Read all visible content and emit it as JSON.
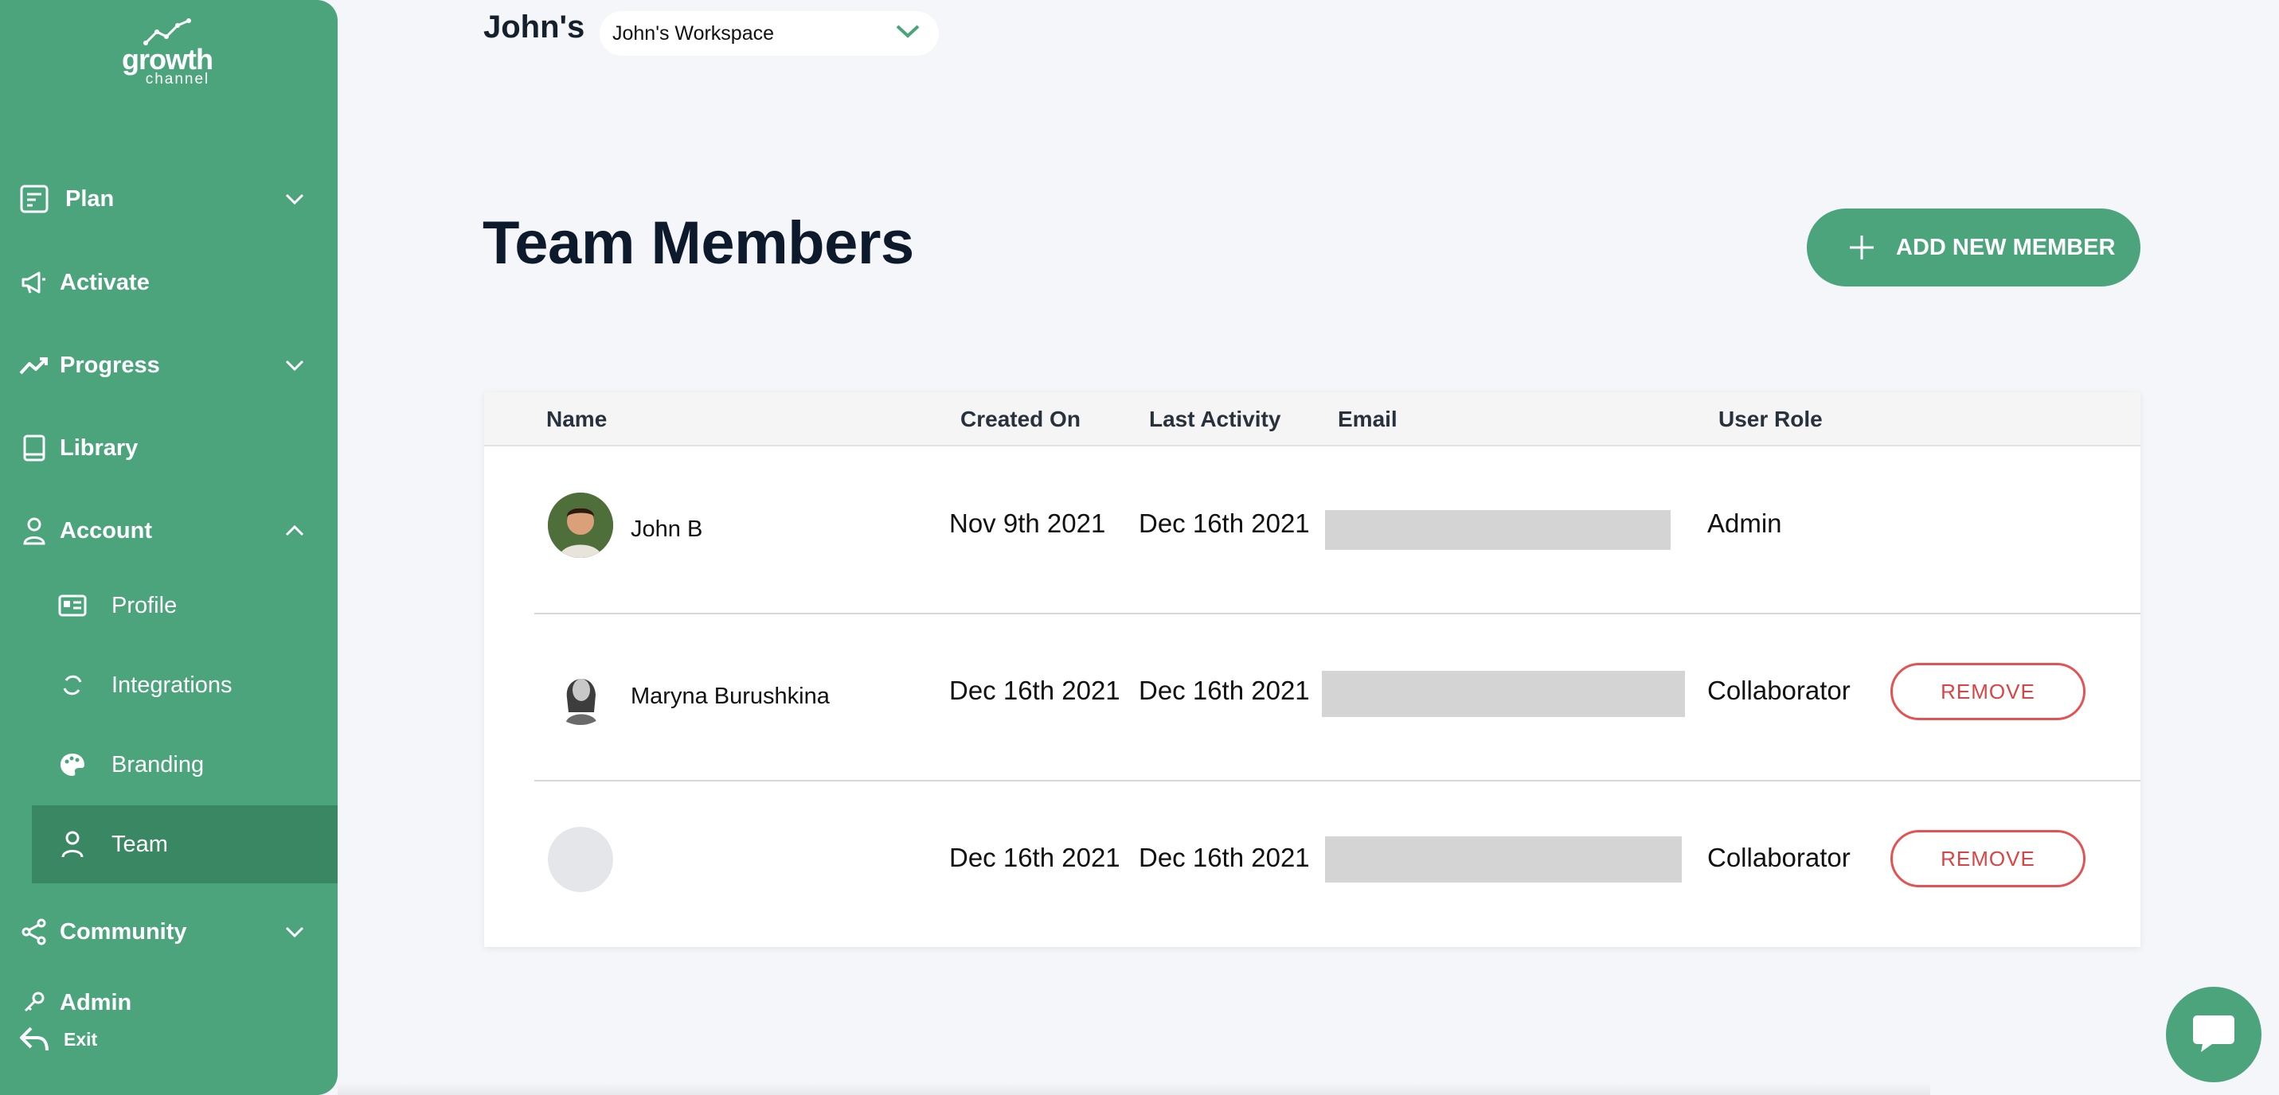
{
  "sidebar": {
    "logo": {
      "line1": "growth",
      "line2": "channel"
    },
    "items": [
      {
        "label": "Plan",
        "icon": "plan-icon",
        "chevron": "down"
      },
      {
        "label": "Activate",
        "icon": "megaphone-icon"
      },
      {
        "label": "Progress",
        "icon": "trend-icon",
        "chevron": "down"
      },
      {
        "label": "Library",
        "icon": "book-icon"
      },
      {
        "label": "Account",
        "icon": "user-icon",
        "chevron": "up"
      },
      {
        "label": "Community",
        "icon": "share-icon",
        "chevron": "down"
      },
      {
        "label": "Admin",
        "icon": "key-icon"
      },
      {
        "label": "Exit",
        "icon": "exit-icon"
      }
    ],
    "account_sub": [
      {
        "label": "Profile",
        "icon": "id-card-icon"
      },
      {
        "label": "Integrations",
        "icon": "sync-icon"
      },
      {
        "label": "Branding",
        "icon": "palette-icon"
      },
      {
        "label": "Team",
        "icon": "person-icon",
        "active": true
      }
    ]
  },
  "header": {
    "workspace_owner": "John's",
    "workspace_select": "John's Workspace"
  },
  "main": {
    "title": "Team Members",
    "add_button": "ADD NEW MEMBER"
  },
  "table": {
    "columns": [
      "Name",
      "Created On",
      "Last Activity",
      "Email",
      "User Role"
    ],
    "rows": [
      {
        "name": "John B",
        "created": "Nov 9th 2021",
        "last_activity": "Dec 16th 2021",
        "email": "",
        "role": "Admin",
        "remove": ""
      },
      {
        "name": "Maryna Burushkina",
        "created": "Dec 16th 2021",
        "last_activity": "Dec 16th 2021",
        "email": "",
        "role": "Collaborator",
        "remove": "REMOVE"
      },
      {
        "name": "",
        "created": "Dec 16th 2021",
        "last_activity": "Dec 16th 2021",
        "email": "",
        "role": "Collaborator",
        "remove": "REMOVE"
      }
    ]
  },
  "colors": {
    "brand_green": "#4ba47c",
    "active_green": "#3a8763",
    "remove_red": "#e35353",
    "page_bg": "#f4f6f9"
  }
}
